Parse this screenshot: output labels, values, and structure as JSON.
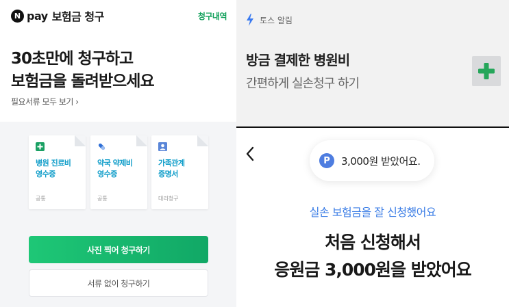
{
  "naverpay": {
    "logo_letter": "N",
    "brand": "pay",
    "header_title": "보험금 청구",
    "history_link": "청구내역",
    "hero_line1": "30초만에 청구하고",
    "hero_line2": "보험금을 돌려받으세요",
    "docs_link": "필요서류 모두 보기",
    "docs_chevron": "›",
    "cards": [
      {
        "icon": "hospital-cross-icon",
        "line1": "병원 진료비",
        "line2": "영수증",
        "tag": "공통"
      },
      {
        "icon": "pill-icon",
        "line1": "약국 약제비",
        "line2": "영수증",
        "tag": "공통"
      },
      {
        "icon": "person-id-icon",
        "line1": "가족관계",
        "line2": "증명서",
        "tag": "대리청구"
      }
    ],
    "primary_button": "사진 찍어 청구하기",
    "secondary_button": "서류 없이 청구하기",
    "colors": {
      "accent_green": "#11a866",
      "card_text_blue": "#0f9dc9"
    }
  },
  "toss_notification": {
    "app_label": "토스 알림",
    "title": "방금 결제한 병원비",
    "subtitle": "간편하게 실손청구 하기",
    "tile_icon": "green-plus-icon"
  },
  "toss_success": {
    "back_icon": "chevron-left-icon",
    "pill_badge": "P",
    "pill_text": "3,000원 받았어요.",
    "blue_text": "실손 보험금을 잘 신청했어요",
    "title_line1": "처음 신청해서",
    "title_line2": "응원금 3,000원을 받았어요",
    "colors": {
      "point_blue": "#4e7de0",
      "text_blue": "#3c7ee6"
    }
  }
}
